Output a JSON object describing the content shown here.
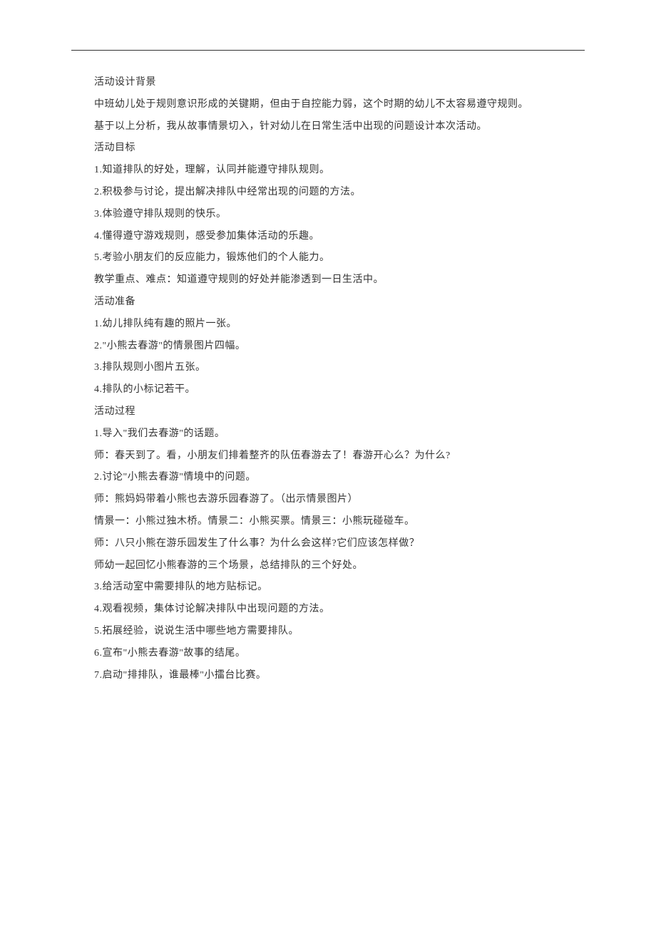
{
  "document": {
    "lines": [
      "活动设计背景",
      "中班幼儿处于规则意识形成的关键期，但由于自控能力弱，这个时期的幼儿不太容易遵守规则。",
      "基于以上分析，我从故事情景切入，针对幼儿在日常生活中出现的问题设计本次活动。",
      "活动目标",
      "1.知道排队的好处，理解，认同并能遵守排队规则。",
      "2.积极参与讨论，提出解决排队中经常出现的问题的方法。",
      "3.体验遵守排队规则的快乐。",
      "4.懂得遵守游戏规则，感受参加集体活动的乐趣。",
      "5.考验小朋友们的反应能力，锻炼他们的个人能力。",
      "教学重点、难点：知道遵守规则的好处并能渗透到一日生活中。",
      "活动准备",
      "1.幼儿排队纯有趣的照片一张。",
      "2.\"小熊去春游\"的情景图片四幅。",
      "3.排队规则小图片五张。",
      "4.排队的小标记若干。",
      "活动过程",
      "1.导入\"我们去春游\"的话题。",
      "师：春天到了。看，小朋友们排着整齐的队伍春游去了！春游开心么？为什么?",
      "2.讨论\"小熊去春游\"情境中的问题。",
      "师：熊妈妈带着小熊也去游乐园春游了。（出示情景图片）",
      "情景一：小熊过独木桥。情景二：小熊买票。情景三：小熊玩碰碰车。",
      "师：八只小熊在游乐园发生了什么事？为什么会这样?它们应该怎样做？",
      "师幼一起回忆小熊春游的三个场景，总结排队的三个好处。",
      "3.给活动室中需要排队的地方贴标记。",
      "4.观看视频，集体讨论解决排队中出现问题的方法。",
      "5.拓展经验，说说生活中哪些地方需要排队。",
      "6.宣布\"小熊去春游\"故事的结尾。",
      "7.启动\"排排队，谁最棒\"小擂台比赛。"
    ]
  }
}
